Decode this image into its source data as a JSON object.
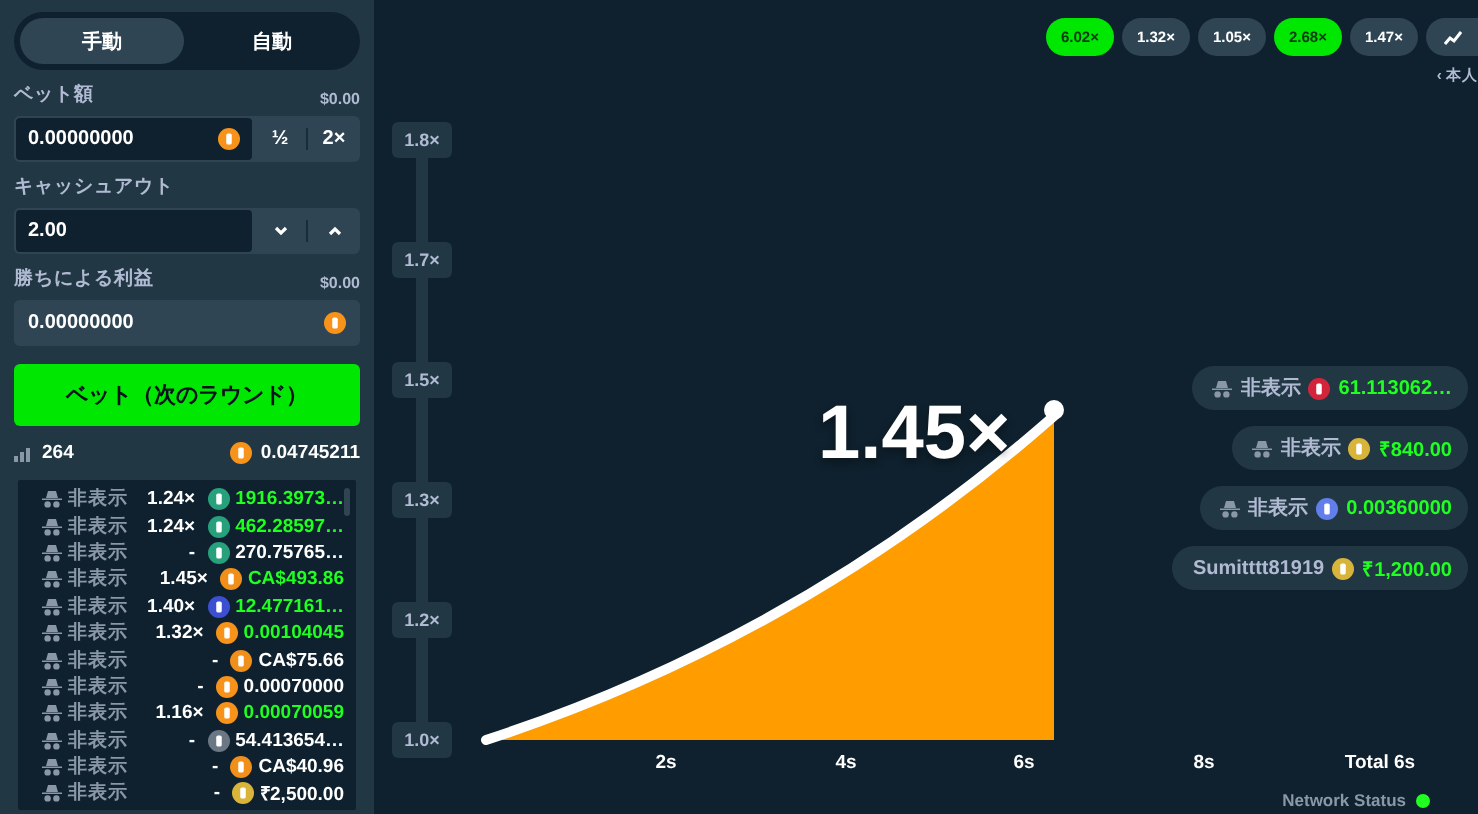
{
  "mode_tabs": [
    {
      "label": "手動",
      "selected": true
    },
    {
      "label": "自動",
      "selected": false
    }
  ],
  "bet_amount": {
    "label": "ベット額",
    "usd": "$0.00",
    "value": "0.00000000",
    "half": "½",
    "double": "2×"
  },
  "cashout": {
    "label": "キャッシュアウト",
    "value": "2.00"
  },
  "profit": {
    "label": "勝ちによる利益",
    "usd": "$0.00",
    "value": "0.00000000",
    "disabled": true
  },
  "bet_button": "ベット（次のラウンド）",
  "stats": {
    "players": "264",
    "total": "0.04745211"
  },
  "bets": [
    {
      "player": "非表示",
      "hidden": true,
      "multiplier": "1.24×",
      "color": "#26a17b",
      "amount": "1916.3973…",
      "won": true
    },
    {
      "player": "非表示",
      "hidden": true,
      "multiplier": "1.24×",
      "color": "#26a17b",
      "amount": "462.28597…",
      "won": true
    },
    {
      "player": "非表示",
      "hidden": true,
      "multiplier": "-",
      "color": "#26a17b",
      "amount": "270.75765…",
      "won": false
    },
    {
      "player": "非表示",
      "hidden": true,
      "multiplier": "1.45×",
      "color": "#f08f1a",
      "amount": "CA$493.86",
      "won": true
    },
    {
      "player": "非表示",
      "hidden": true,
      "multiplier": "1.40×",
      "color": "#3b4fd0",
      "amount": "12.477161…",
      "won": true
    },
    {
      "player": "非表示",
      "hidden": true,
      "multiplier": "1.32×",
      "color": "#f7931a",
      "amount": "0.00104045",
      "won": true
    },
    {
      "player": "非表示",
      "hidden": true,
      "multiplier": "-",
      "color": "#f08f1a",
      "amount": "CA$75.66",
      "won": false
    },
    {
      "player": "非表示",
      "hidden": true,
      "multiplier": "-",
      "color": "#f7931a",
      "amount": "0.00070000",
      "won": false
    },
    {
      "player": "非表示",
      "hidden": true,
      "multiplier": "1.16×",
      "color": "#f7931a",
      "amount": "0.00070059",
      "won": true
    },
    {
      "player": "非表示",
      "hidden": true,
      "multiplier": "-",
      "color": "#6b7785",
      "amount": "54.413654…",
      "won": false
    },
    {
      "player": "非表示",
      "hidden": true,
      "multiplier": "-",
      "color": "#f08f1a",
      "amount": "CA$40.96",
      "won": false
    },
    {
      "player": "非表示",
      "hidden": true,
      "multiplier": "-",
      "color": "#d9b43a",
      "amount": "₹2,500.00",
      "won": false
    }
  ],
  "history": [
    {
      "value": "6.02×",
      "won": true
    },
    {
      "value": "1.32×",
      "won": false
    },
    {
      "value": "1.05×",
      "won": false
    },
    {
      "value": "2.68×",
      "won": true
    },
    {
      "value": "1.47×",
      "won": false
    }
  ],
  "own_label": "‹ 本人",
  "chart": {
    "y_labels": [
      "1.8×",
      "1.7×",
      "1.5×",
      "1.3×",
      "1.2×",
      "1.0×"
    ],
    "x_labels": [
      "2s",
      "4s",
      "6s",
      "8s"
    ],
    "total": "Total 6s",
    "multiplier": "1.45×"
  },
  "live_bets": [
    {
      "player": "非表示",
      "hidden": true,
      "color": "#d3243c",
      "amount": "61.113062…"
    },
    {
      "player": "非表示",
      "hidden": true,
      "color": "#d9b43a",
      "amount": "₹840.00"
    },
    {
      "player": "非表示",
      "hidden": true,
      "color": "#627eea",
      "amount": "0.00360000"
    },
    {
      "player": "Sumitttt81919",
      "hidden": false,
      "color": "#d9b43a",
      "amount": "₹1,200.00"
    }
  ],
  "network": {
    "label": "Network Status",
    "online": true
  }
}
